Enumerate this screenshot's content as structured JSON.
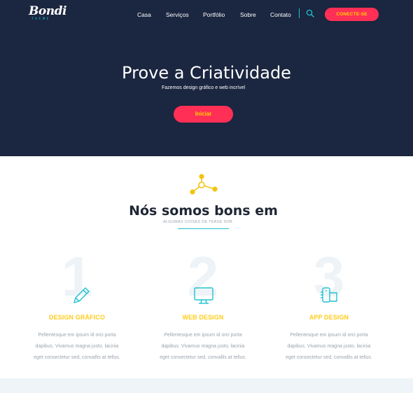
{
  "brand": {
    "name": "Bondi",
    "tagline": "THEME"
  },
  "nav": {
    "items": [
      "Casa",
      "Serviços",
      "Portfólio",
      "Sobre",
      "Contato"
    ],
    "connect_label": "CONECTE-SE",
    "search_icon": "search-icon"
  },
  "hero": {
    "title": "Prove a Criatividade",
    "subtitle": "Fazemos design gráfico e web incrível",
    "button_label": "Iniciar"
  },
  "section": {
    "icon": "share-nodes-icon",
    "title": "Nós somos bons em",
    "subtitle": "ALGUMAS COISAS DE TEASE SOB"
  },
  "features": [
    {
      "number": "1",
      "icon": "pencil-icon",
      "title": "DESIGN GRÁFICO",
      "lines": [
        "Pellentesque em ipsum id orci porta",
        "dapibus. Vivamus magna justo, lacinia",
        "eget consectetur sed, convallis at tellus."
      ]
    },
    {
      "number": "2",
      "icon": "monitor-icon",
      "title": "WEB DESIGN",
      "lines": [
        "Pellentesque em ipsum id orci porta",
        "dapibus. Vivamus magna justo, lacinia",
        "eget consectetur sed, convallis at tellus."
      ]
    },
    {
      "number": "3",
      "icon": "mobile-app-icon",
      "title": "APP DESIGN",
      "lines": [
        "Pellentesque em ipsum id orci porta",
        "dapibus. Vivamus magna justo, lacinia",
        "eget consectetur sed, convallis at tellus."
      ]
    }
  ],
  "colors": {
    "hero_bg": "#1b2640",
    "accent_pink": "#ff2f55",
    "accent_yellow": "#ffd400",
    "accent_teal": "#1fc2cf",
    "feature_title": "#ffcc1a"
  }
}
